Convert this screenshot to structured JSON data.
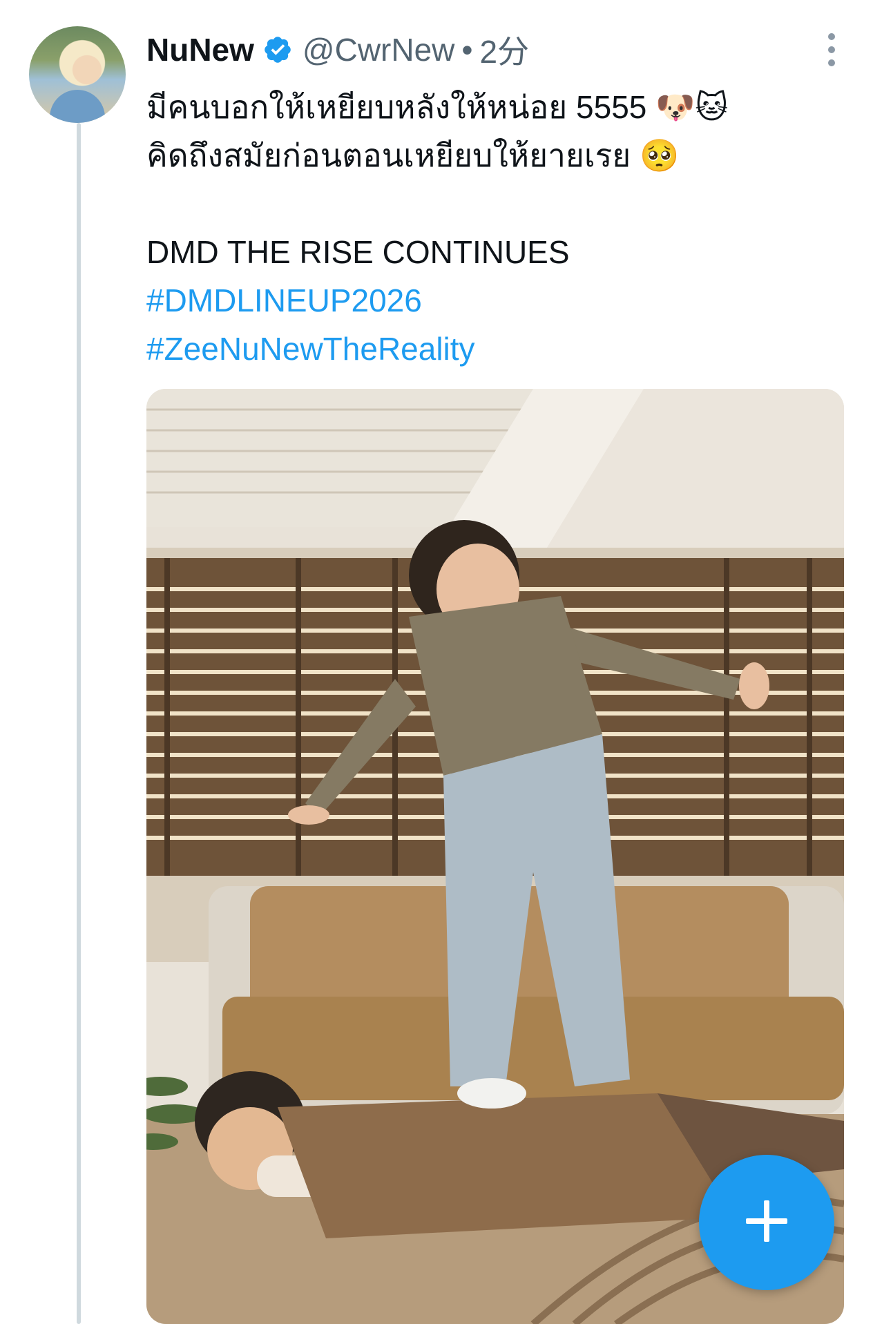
{
  "tweet": {
    "display_name": "NuNew",
    "handle": "@CwrNew",
    "separator": "•",
    "time": "2分",
    "text_lines": [
      "มีคนบอกให้เหยียบหลังให้หน่อย 5555 🐶🐱",
      "คิดถึงสมัยก่อนตอนเหยียบให้ยายเรย 🥺",
      "DMD THE RISE CONTINUES"
    ],
    "hashtags": [
      "#DMDLINEUP2026",
      "#ZeeNuNewTheReality"
    ]
  },
  "icons": {
    "verified": "verified-badge-icon",
    "more": "more-vertical-icon",
    "compose": "plus-icon"
  },
  "colors": {
    "accent": "#1d9bf0",
    "secondary_text": "#536471",
    "thread_line": "#cfd9de"
  }
}
